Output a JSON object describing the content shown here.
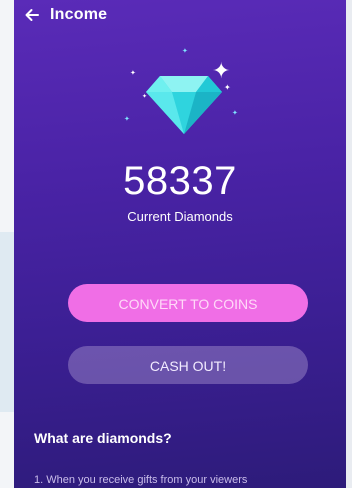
{
  "header": {
    "title": "Income"
  },
  "diamonds": {
    "amount": "58337",
    "label": "Current Diamonds"
  },
  "buttons": {
    "convert_label": "CONVERT TO COINS",
    "cashout_label": "CASH OUT!"
  },
  "faq": {
    "title": "What are diamonds?",
    "items": [
      "1. When you receive gifts from your viewers"
    ]
  },
  "colors": {
    "background_top": "#5a2bb8",
    "background_bottom": "#2d1b7a",
    "convert_button": "#f06ee6",
    "cashout_button": "#8a73b8",
    "diamond": "#3fe0e6"
  },
  "icons": {
    "back": "arrow-left-icon",
    "diamond": "diamond-icon",
    "sparkle": "sparkle-icon"
  }
}
